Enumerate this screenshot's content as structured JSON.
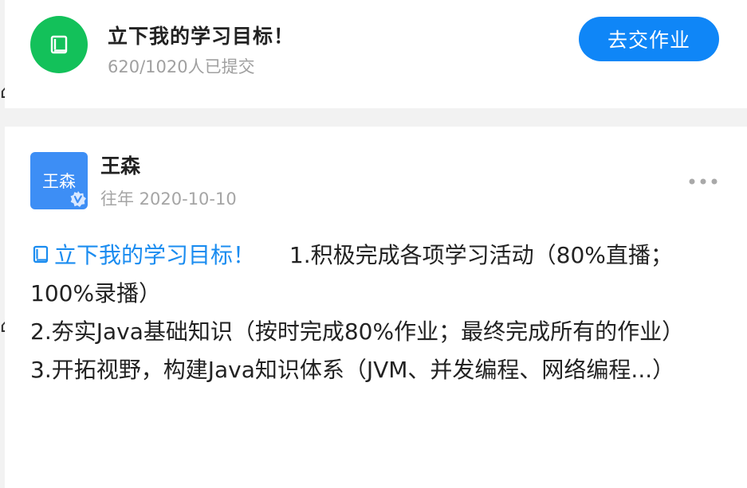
{
  "task_card": {
    "title": "立下我的学习目标！",
    "submission_count": "620/1020人已提交",
    "submit_button_label": "去交作业",
    "icon": "book-icon"
  },
  "post": {
    "avatar_text": "王森",
    "author_name": "王森",
    "meta": "往年 2020-10-10",
    "more_icon": "more-dots-icon",
    "task_link_label": "立下我的学习目标！",
    "lines": [
      "1.积极完成各项学习活动（80%直播；100%录播）",
      "2.夯实Java基础知识（按时完成80%作业；最终完成所有的作业）",
      "3.开拓视野，构建Java知识体系（JVM、并发编程、网络编程...）"
    ]
  },
  "colors": {
    "green_icon_bg": "#13c15a",
    "primary_blue": "#0f86f7",
    "avatar_blue": "#3d8ef5",
    "link_blue": "#1a8cf0"
  }
}
